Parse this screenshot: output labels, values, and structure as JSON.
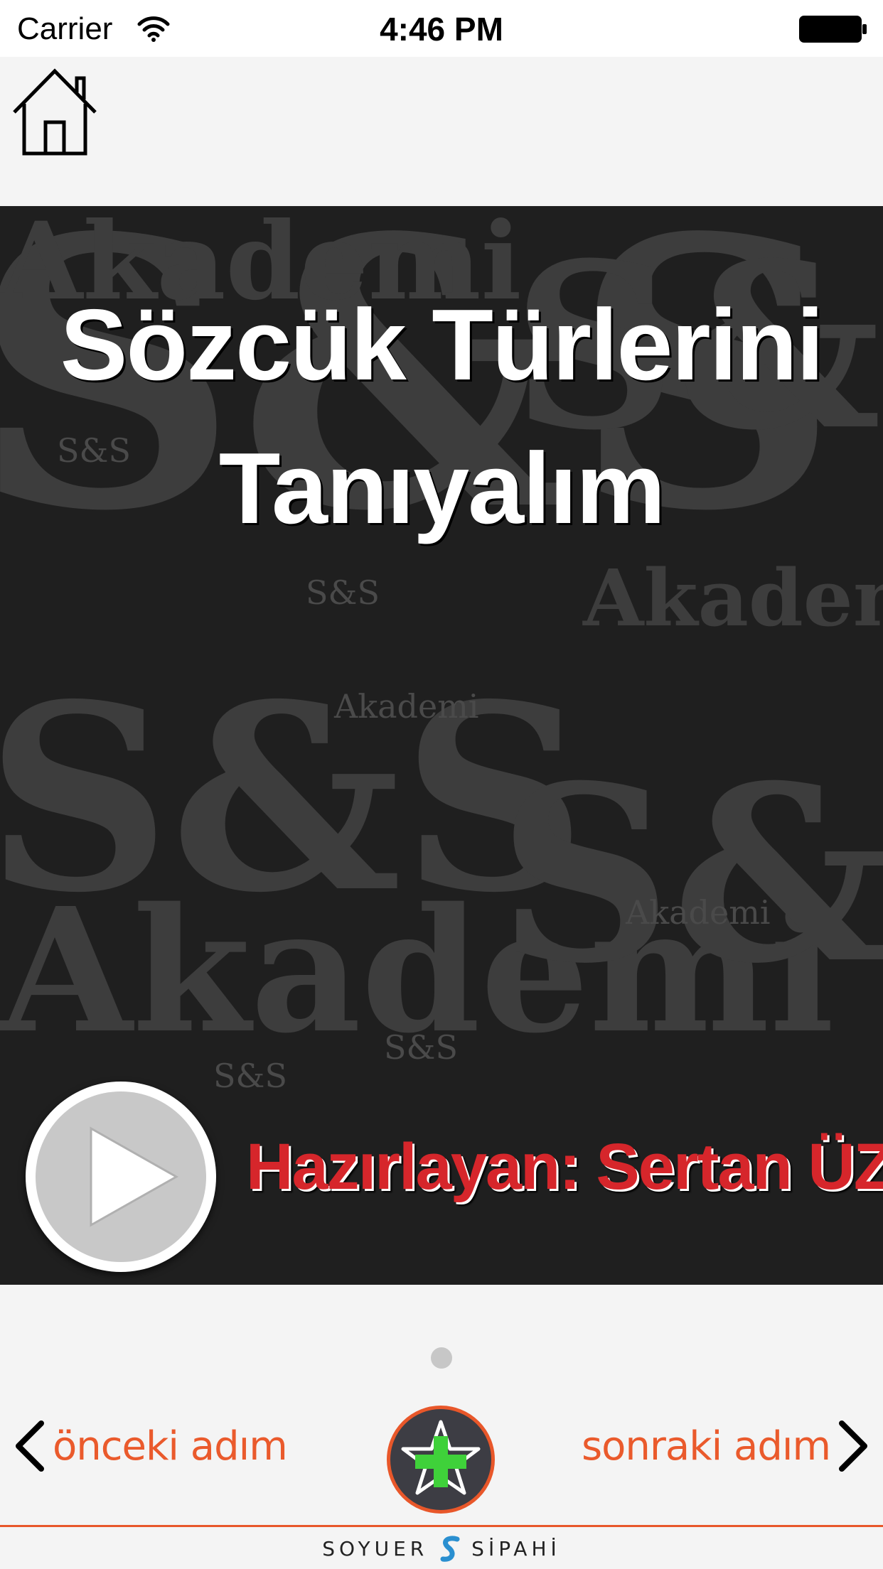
{
  "status_bar": {
    "carrier": "Carrier",
    "time": "4:46 PM"
  },
  "icons": {
    "home": "home-icon",
    "wifi": "wifi-icon",
    "battery": "battery-icon",
    "play": "play-icon",
    "chevron_left": "chevron-left-icon",
    "chevron_right": "chevron-right-icon",
    "center": "star-plus-icon"
  },
  "slide": {
    "title_line1": "Sözcük Türlerini",
    "title_line2": "Tanıyalım",
    "author": "Hazırlayan: Sertan ÜZE",
    "background_words": [
      "S&S",
      "Akademi",
      "S&S",
      "Akademi",
      "S&S",
      "Akademi",
      "S&S"
    ]
  },
  "nav": {
    "prev_label": "önceki adım",
    "next_label": "sonraki adım"
  },
  "footer": {
    "brand_left": "SOYUER",
    "brand_right": "SİPAHİ"
  },
  "colors": {
    "accent": "#e8572a",
    "author_red": "#d6262b",
    "slide_bg": "#1f1f1f",
    "center_button_bg": "#3d3d44",
    "plus_green": "#3fd13a"
  }
}
